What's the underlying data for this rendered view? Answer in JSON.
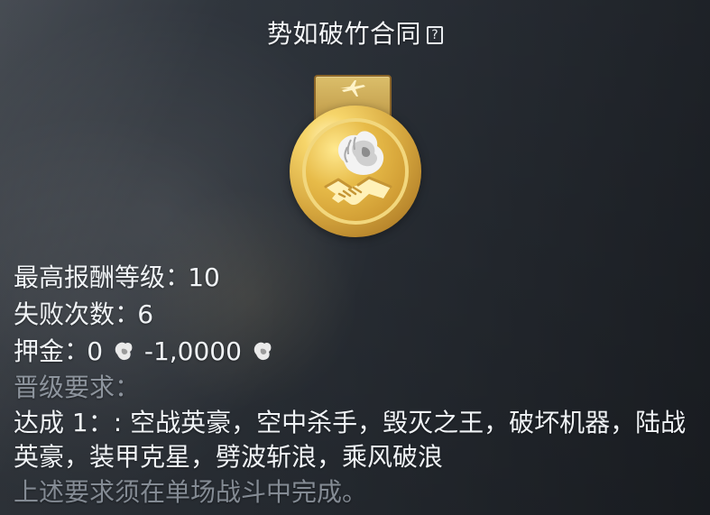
{
  "header": {
    "title": "势如破竹合同",
    "help_icon": "question-icon"
  },
  "medal": {
    "ribbon_icon": "airplane-icon",
    "emblem_icon": "lion-head-icon",
    "center_icon": "handshake-icon",
    "colors": {
      "gold_light": "#f7db7b",
      "gold_mid": "#d5a63e",
      "gold_dark": "#9b6a1d",
      "silver": "#ececec"
    }
  },
  "stats": {
    "max_reward_level_label": "最高报酬等级",
    "max_reward_level_value": "10",
    "failures_label": "失败次数",
    "failures_value": "6",
    "deposit_label": "押金",
    "deposit_min": "0",
    "deposit_separator": "-",
    "deposit_max": "1,0000",
    "deposit_icon": "lion-head-icon",
    "promotion_label": "晋级要求："
  },
  "requirement": {
    "prefix": "达成 1：",
    "colon_extra": ":",
    "items_text": "空战英豪，空中杀手，毁灭之王，破坏机器，陆战英豪，装甲克星，劈波斩浪，乘风破浪"
  },
  "footer": {
    "note": "上述要求须在单场战斗中完成。"
  },
  "colors": {
    "text_primary": "#f0f3f6",
    "text_muted": "#8d949d",
    "background_dark": "#2a2f36"
  }
}
